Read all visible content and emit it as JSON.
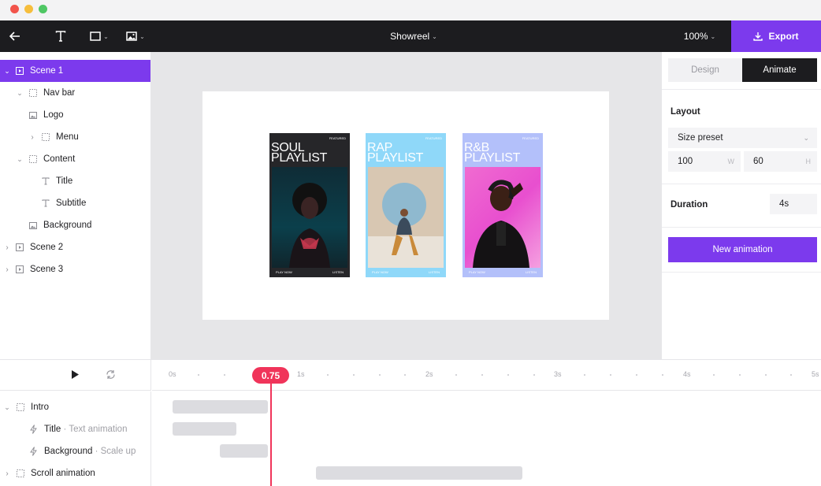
{
  "window": {
    "traffic_lights": {
      "close": "#f2544b",
      "minimize": "#f6be3c",
      "zoom": "#4fc764"
    }
  },
  "toolbar": {
    "back_icon": "arrow-left-icon",
    "text_tool_icon": "text-tool-icon",
    "shape_tool_icon": "rectangle-tool-icon",
    "image_tool_icon": "image-tool-icon",
    "document_title": "Showreel",
    "zoom_level": "100%",
    "export_label": "Export"
  },
  "layers": {
    "items": [
      {
        "label": "Scene 1",
        "icon": "scene-icon",
        "expanded": true,
        "active": true
      },
      {
        "label": "Nav bar",
        "icon": "frame-icon",
        "expanded": true
      },
      {
        "label": "Logo",
        "icon": "image-icon"
      },
      {
        "label": "Menu",
        "icon": "frame-icon",
        "expanded": false
      },
      {
        "label": "Content",
        "icon": "frame-icon",
        "expanded": true
      },
      {
        "label": "Title",
        "icon": "text-icon"
      },
      {
        "label": "Subtitle",
        "icon": "text-icon"
      },
      {
        "label": "Background",
        "icon": "image-icon"
      },
      {
        "label": "Scene 2",
        "icon": "scene-icon",
        "expanded": false
      },
      {
        "label": "Scene 3",
        "icon": "scene-icon",
        "expanded": false
      }
    ]
  },
  "canvas": {
    "cards": [
      {
        "title_line1": "SOUL",
        "title_line2": "PLAYLIST",
        "background": "#262629",
        "tag": "FEATURED",
        "footer_left": "PLAY NOW",
        "footer_right": "LISTEN"
      },
      {
        "title_line1": "RAP",
        "title_line2": "PLAYLIST",
        "background": "#8fd8f9",
        "tag": "FEATURED",
        "footer_left": "PLAY NOW",
        "footer_right": "LISTEN"
      },
      {
        "title_line1": "R&B",
        "title_line2": "PLAYLIST",
        "background": "#b3c0fa",
        "tag": "FEATURED",
        "footer_left": "PLAY NOW",
        "footer_right": "LISTEN"
      }
    ]
  },
  "panel": {
    "tabs": [
      "Design",
      "Animate"
    ],
    "selected_tab": "Animate",
    "layout_label": "Layout",
    "size_preset": "Size preset",
    "width_value": "100",
    "width_unit": "W",
    "height_value": "60",
    "height_unit": "H",
    "duration_label": "Duration",
    "duration_value": "4s",
    "new_animation_label": "New animation"
  },
  "timeline": {
    "play_icon": "play-icon",
    "loop_icon": "loop-icon",
    "ticks": [
      "0s",
      "1s",
      "2s",
      "3s",
      "4s",
      "5s"
    ],
    "playhead_value": "0.75",
    "tracks": [
      {
        "label": "Intro",
        "sub": "",
        "icon": "frame-icon",
        "expanded": true
      },
      {
        "label": "Title",
        "sub": " · Text animation",
        "icon": "bolt-icon"
      },
      {
        "label": "Background",
        "sub": " · Scale up",
        "icon": "bolt-icon"
      },
      {
        "label": "Scroll animation",
        "sub": "",
        "icon": "frame-icon",
        "expanded": false
      }
    ]
  },
  "colors": {
    "accent": "#7c3aed",
    "playhead": "#f0345a",
    "toolbar_bg": "#1c1c1f"
  }
}
